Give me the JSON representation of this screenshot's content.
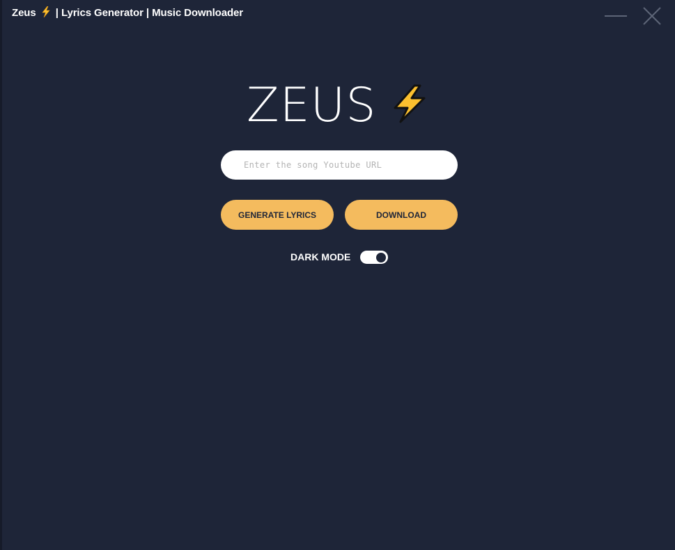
{
  "window": {
    "title_prefix": "Zeus",
    "title_suffix": "| Lyrics Generator | Music Downloader",
    "bolt_icon": "lightning-bolt-icon"
  },
  "logo": {
    "text": "ZEUS",
    "icon": "lightning-bolt-icon"
  },
  "search": {
    "value": "",
    "placeholder": "Enter the song Youtube URL"
  },
  "actions": {
    "generate_label": "GENERATE LYRICS",
    "download_label": "DOWNLOAD"
  },
  "settings": {
    "dark_mode_label": "DARK MODE",
    "dark_mode_on": true
  },
  "colors": {
    "background": "#1e2538",
    "accent": "#f4bb5e",
    "bolt": "#fcc02f",
    "text": "#ffffff"
  }
}
